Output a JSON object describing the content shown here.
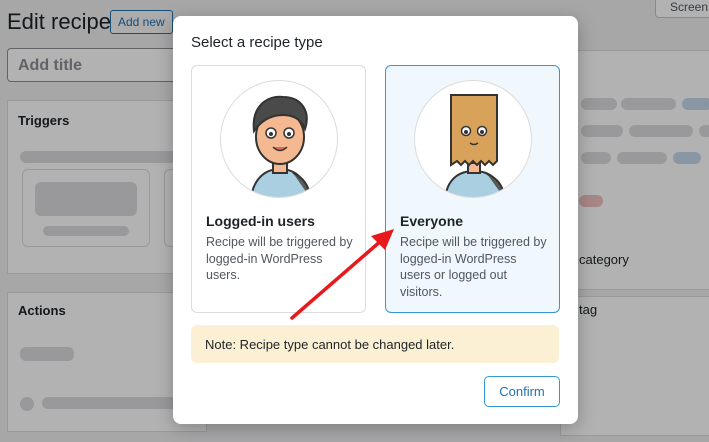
{
  "page": {
    "title": "Edit recipe",
    "add_new_label": "Add new",
    "screen_options_label": "Screen",
    "title_placeholder": "Add title",
    "triggers_title": "Triggers",
    "actions_title": "Actions",
    "category_label": "category",
    "tag_label": "tag"
  },
  "modal": {
    "title": "Select a recipe type",
    "options": [
      {
        "label": "Logged-in users",
        "description": "Recipe will be triggered by logged-in WordPress users.",
        "selected": false
      },
      {
        "label": "Everyone",
        "description": "Recipe will be triggered by logged-in WordPress users or logged out visitors.",
        "selected": true
      }
    ],
    "note": "Note: Recipe type cannot be changed later.",
    "confirm_label": "Confirm"
  },
  "colors": {
    "accent": "#3497d3",
    "note_bg": "#fcf0d4",
    "annotation_arrow": "#e8191c"
  }
}
